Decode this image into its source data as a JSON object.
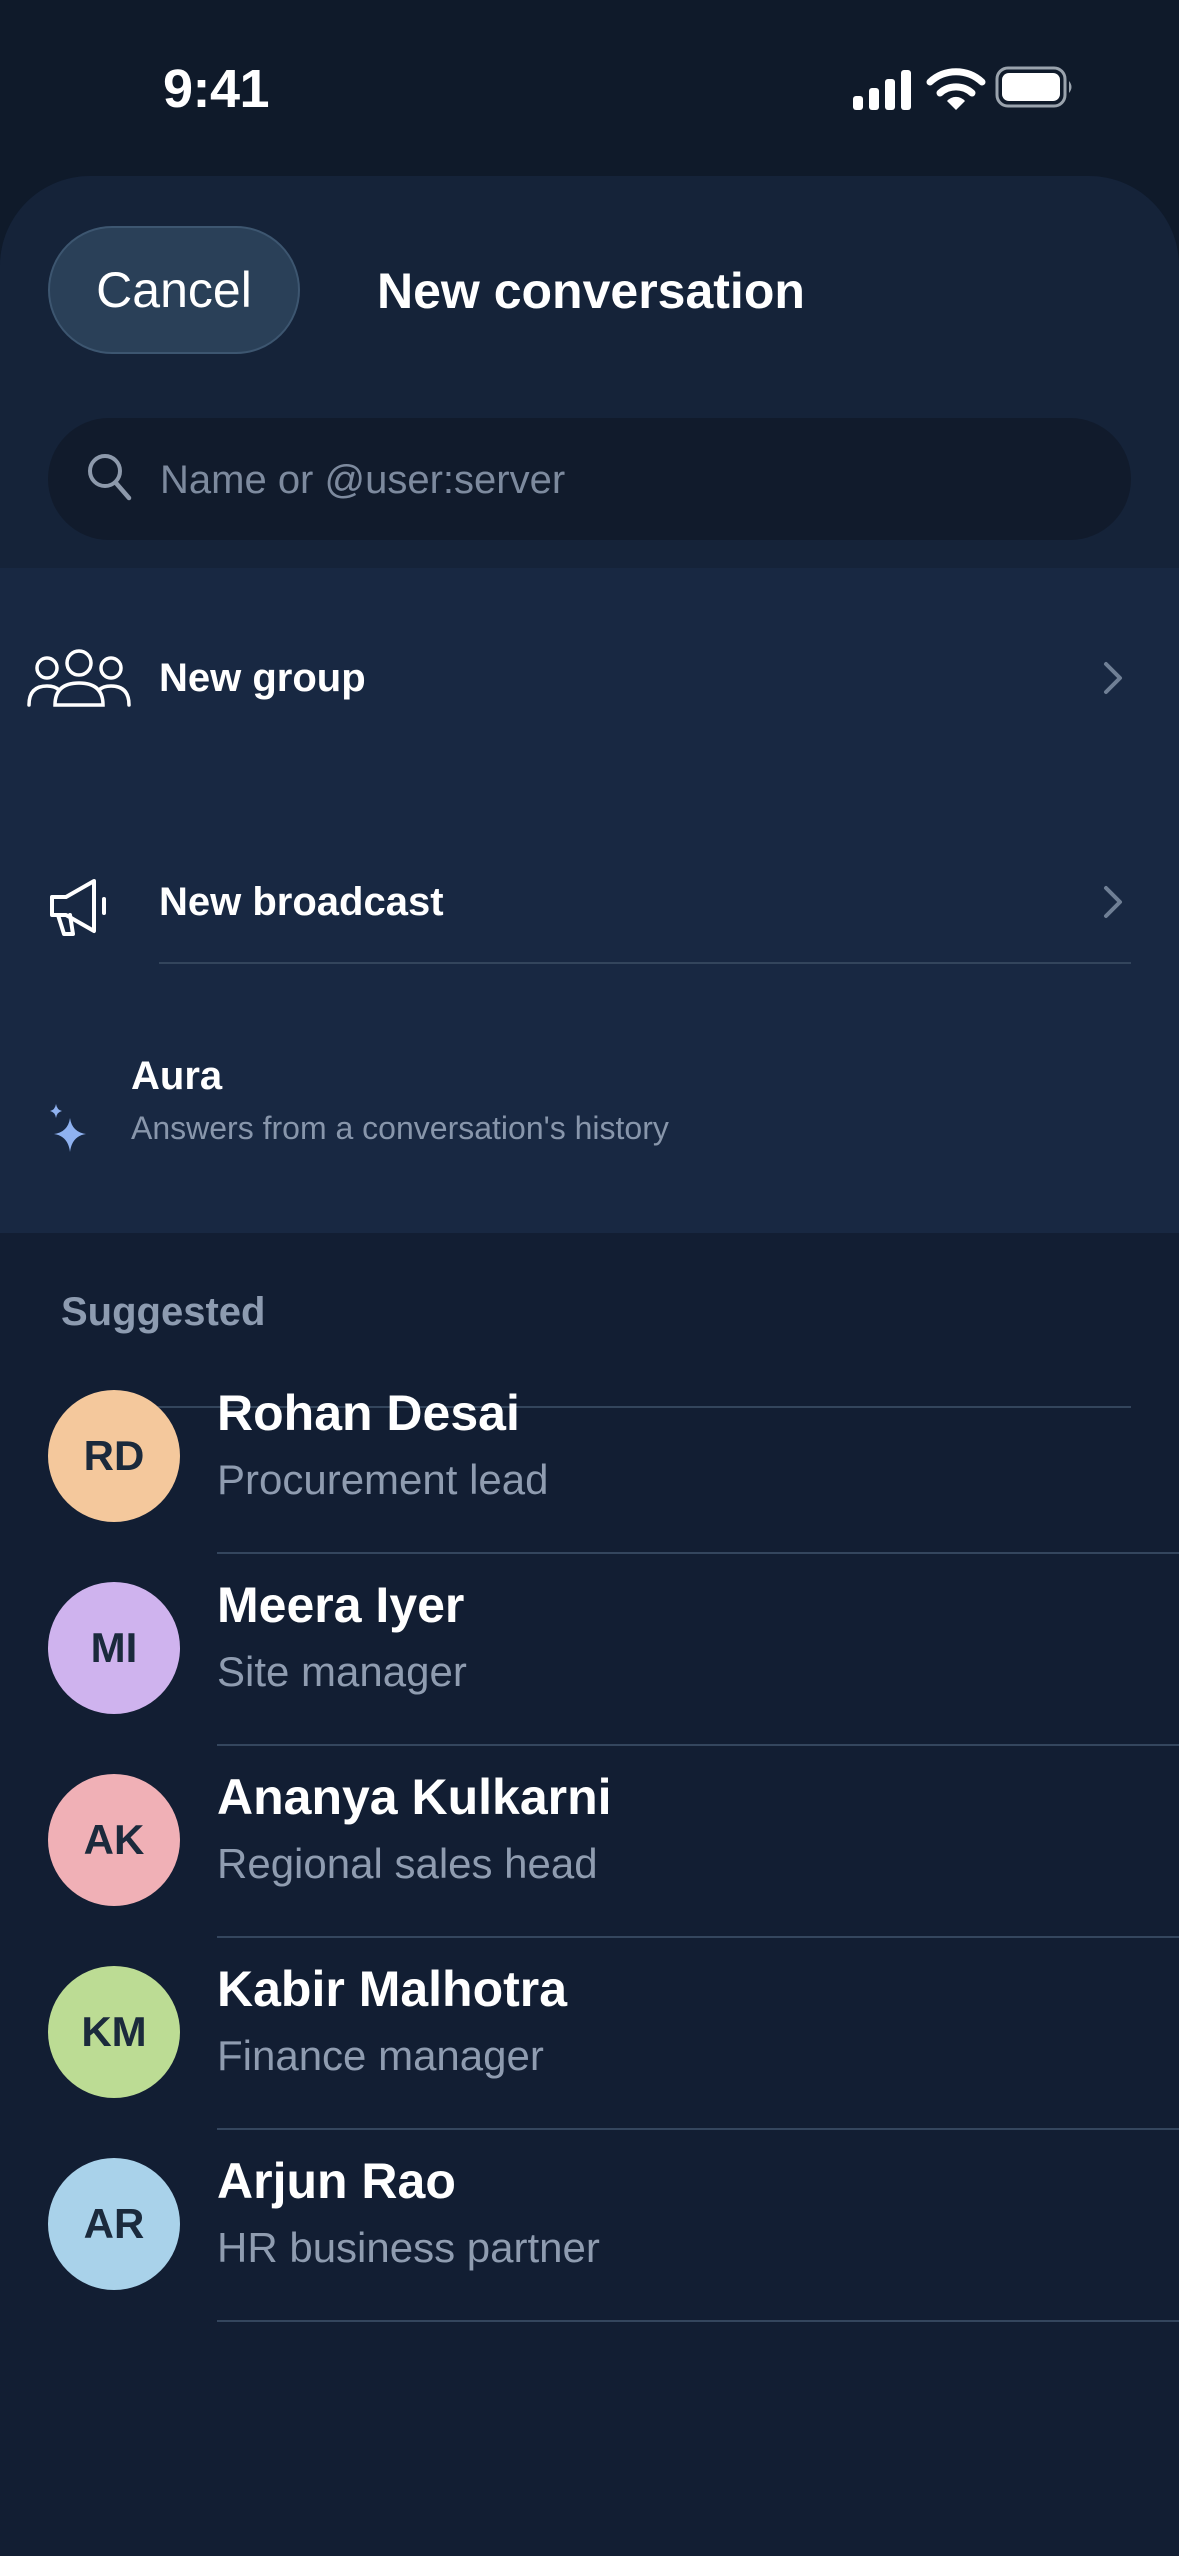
{
  "status_bar": {
    "time": "9:41"
  },
  "header": {
    "cancel_label": "Cancel",
    "title": "New conversation"
  },
  "search": {
    "placeholder": "Name or @user:server",
    "value": ""
  },
  "actions": [
    {
      "icon": "people-group-icon",
      "label": "New group"
    },
    {
      "icon": "megaphone-icon",
      "label": "New broadcast"
    },
    {
      "icon": "sparkle-icon",
      "label": "Aura",
      "subtitle": "Answers from a conversation's history"
    }
  ],
  "suggested": {
    "heading": "Suggested",
    "contacts": [
      {
        "initials": "RD",
        "name": "Rohan Desai",
        "role": "Procurement lead",
        "color": "#f4c89c"
      },
      {
        "initials": "MI",
        "name": "Meera Iyer",
        "role": "Site manager",
        "color": "#cfb3ee"
      },
      {
        "initials": "AK",
        "name": "Ananya Kulkarni",
        "role": "Regional sales head",
        "color": "#f0b0b6"
      },
      {
        "initials": "KM",
        "name": "Kabir Malhotra",
        "role": "Finance manager",
        "color": "#bcdc94"
      },
      {
        "initials": "AR",
        "name": "Arjun Rao",
        "role": "HR business partner",
        "color": "#a9d2ea"
      }
    ]
  },
  "colors": {
    "sheet_bg": "#121e33",
    "actions_bg": "#182842",
    "accent_sparkle": "#8fb2f0"
  }
}
